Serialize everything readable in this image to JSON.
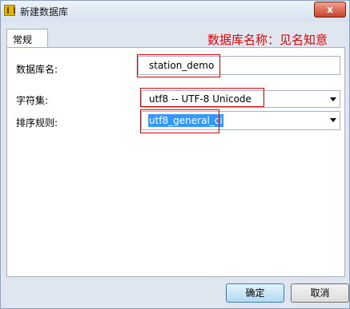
{
  "window": {
    "title": "新建数据库",
    "close_label": "x"
  },
  "tabs": [
    {
      "label": "常规"
    }
  ],
  "annotation": "数据库名称：见名知意",
  "form": {
    "db_name_label": "数据库名:",
    "db_name_value": "station_demo",
    "charset_label": "字符集:",
    "charset_value": "utf8 -- UTF-8 Unicode",
    "collation_label": "排序规则:",
    "collation_value": "utf8_general_ci"
  },
  "buttons": {
    "ok": "确定",
    "cancel": "取消"
  },
  "colors": {
    "annotation": "#e00000",
    "selection": "#3399ff"
  }
}
